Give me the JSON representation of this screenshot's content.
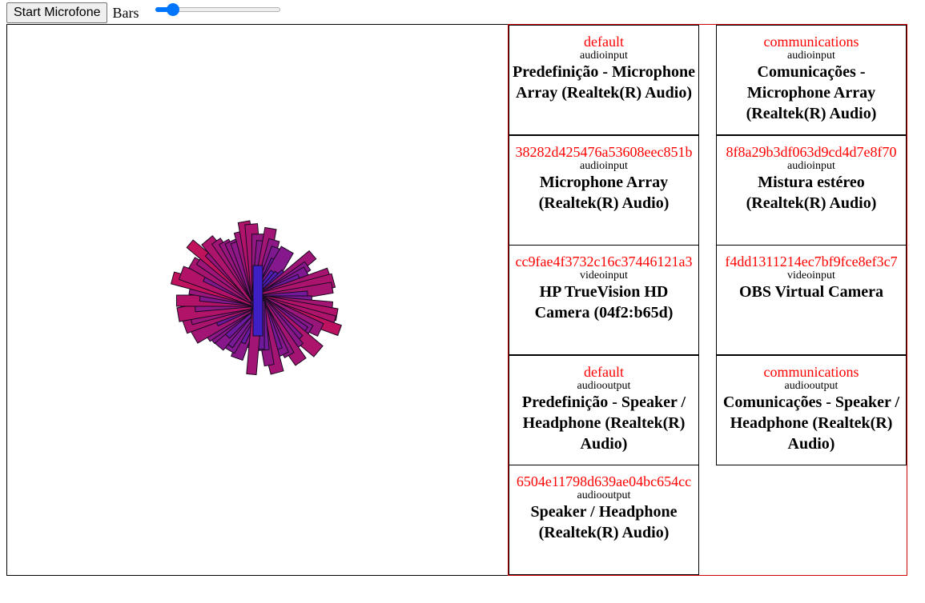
{
  "toolbar": {
    "start_button_label": "Start Microfone",
    "mode_label": "Bars",
    "slider_value_fraction": 0.1
  },
  "visualizer": {
    "center_color": "#3d1fc4",
    "edge_color": "#d01050"
  },
  "devices": [
    {
      "id": "default",
      "kind": "audioinput",
      "label": "Predefinição - Microphone Array (Realtek(R) Audio)"
    },
    {
      "id": "communications",
      "kind": "audioinput",
      "label": "Comunicações - Microphone Array (Realtek(R) Audio)"
    },
    {
      "id": "38282d425476a53608eec851b",
      "kind": "audioinput",
      "label": "Microphone Array (Realtek(R) Audio)"
    },
    {
      "id": "8f8a29b3df063d9cd4d7e8f70",
      "kind": "audioinput",
      "label": "Mistura estéreo (Realtek(R) Audio)"
    },
    {
      "id": "cc9fae4f3732c16c37446121a3",
      "kind": "videoinput",
      "label": "HP TrueVision HD Camera (04f2:b65d)"
    },
    {
      "id": "f4dd1311214ec7bf9fce8ef3c7",
      "kind": "videoinput",
      "label": "OBS Virtual Camera"
    },
    {
      "id": "default",
      "kind": "audiooutput",
      "label": "Predefinição - Speaker / Headphone (Realtek(R) Audio)"
    },
    {
      "id": "communications",
      "kind": "audiooutput",
      "label": "Comunicações - Speaker / Headphone (Realtek(R) Audio)"
    },
    {
      "id": "6504e11798d639ae04bc654cc",
      "kind": "audiooutput",
      "label": "Speaker / Headphone (Realtek(R) Audio)"
    }
  ]
}
